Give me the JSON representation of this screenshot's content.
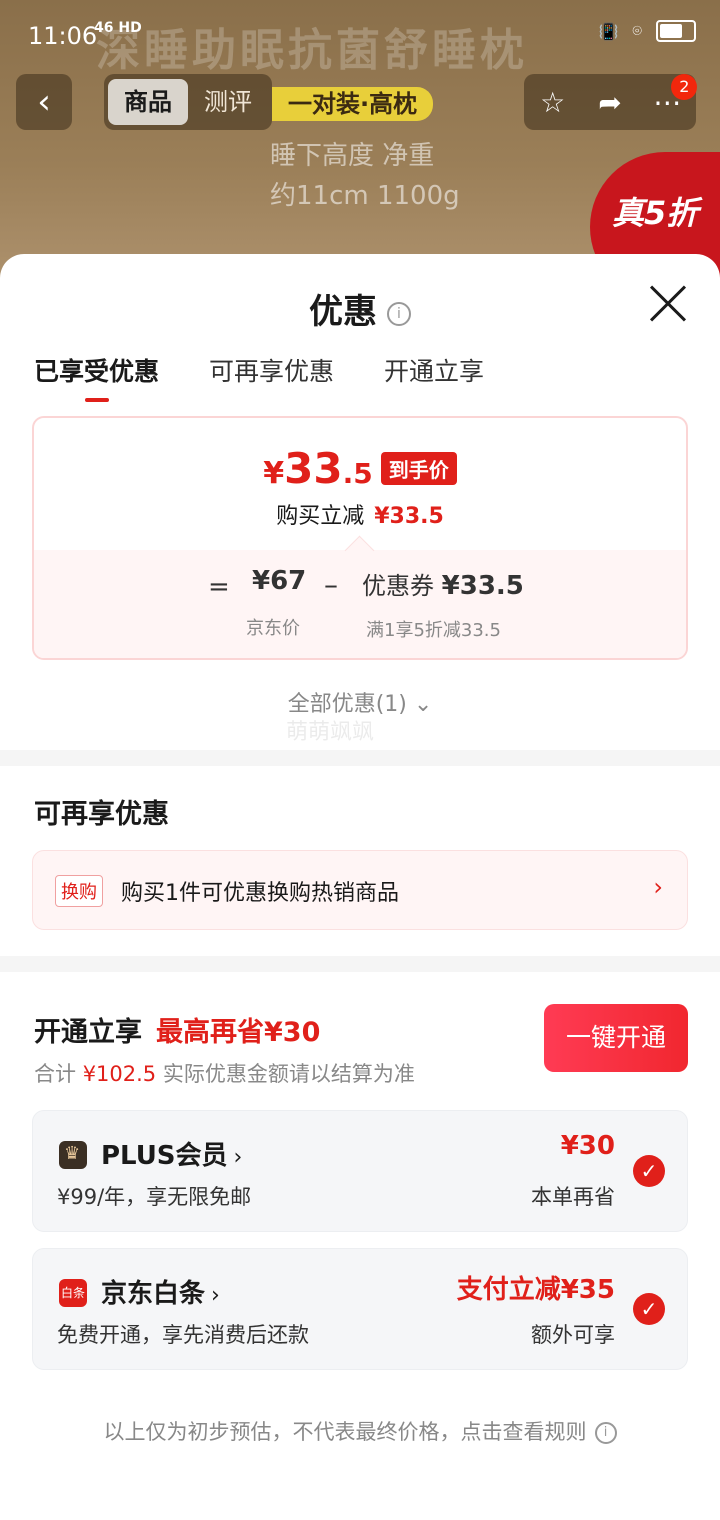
{
  "status_bar": {
    "time": "11:06",
    "network": "46 HD"
  },
  "background": {
    "headline": "深睡助眠抗菌舒睡枕",
    "nav_tabs": [
      "商品",
      "测评"
    ],
    "product_tag": "一对装·高枕",
    "spec_line1": "睡下高度 净重",
    "spec_line2": "约11cm 1100g",
    "promo_label": "真5折",
    "badge_count": "2"
  },
  "sheet": {
    "title": "优惠",
    "tabs": [
      "已享受优惠",
      "可再享优惠",
      "开通立享"
    ],
    "price": {
      "yen": "¥",
      "integer": "33",
      "decimal": ".5",
      "tag": "到手价",
      "reduce_label": "购买立减",
      "reduce_value": "¥33.5",
      "eq": "=",
      "jd_value": "¥67",
      "jd_label": "京东价",
      "minus": "–",
      "coupon_label": "优惠券",
      "coupon_value": "¥33.5",
      "coupon_rule": "满1享5折减33.5"
    },
    "all_offers": "全部优惠(1)",
    "watermark": "萌萌飒飒",
    "reenjoy": {
      "title": "可再享优惠",
      "tag": "换购",
      "text": "购买1件可优惠换购热销商品"
    },
    "open": {
      "title": "开通立享",
      "highlight": "最高再省¥30",
      "sub_prefix": "合计",
      "sub_amount": "¥102.5",
      "sub_suffix": "实际优惠金额请以结算为准",
      "button": "一键开通"
    },
    "services": [
      {
        "name": "PLUS会员",
        "desc": "¥99/年，享无限免邮",
        "amount": "¥30",
        "note": "本单再省",
        "icon": "crown-icon"
      },
      {
        "name": "京东白条",
        "desc": "免费开通，享先消费后还款",
        "amount": "支付立减¥35",
        "note": "额外可享",
        "icon": "baitiao-icon",
        "icon_text": "白条"
      }
    ],
    "footer": "以上仅为初步预估，不代表最终价格，点击查看规则"
  }
}
